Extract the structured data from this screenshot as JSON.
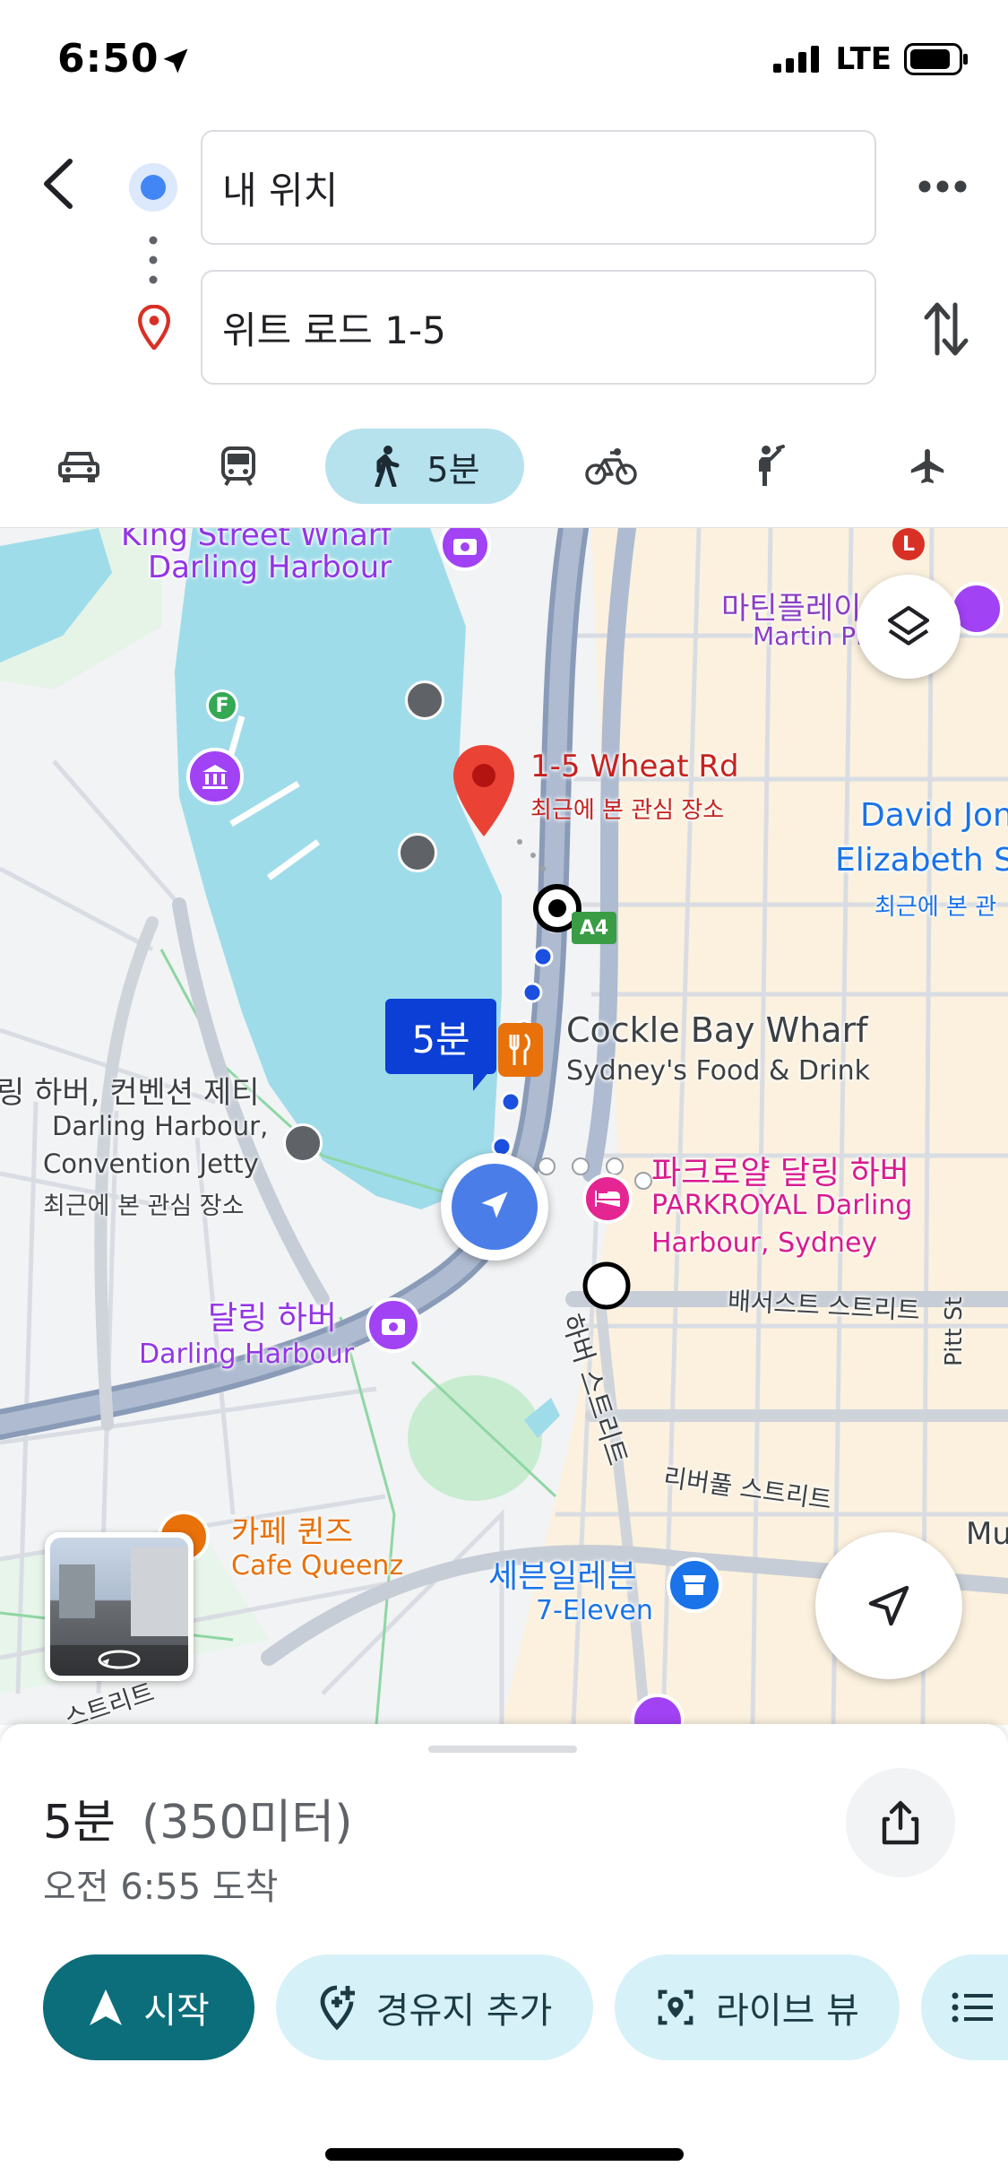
{
  "status": {
    "time": "6:50",
    "network": "LTE"
  },
  "search": {
    "origin": "내 위치",
    "destination": "위트 로드 1-5"
  },
  "modes": {
    "walk_time": "5분"
  },
  "map": {
    "labels": {
      "king_street": "King Street Wharf",
      "darling_top": "Darling Harbour",
      "martin_ko": "마틴플레이",
      "martin_en": "Martin Pl",
      "dest_title": "1-5 Wheat Rd",
      "dest_sub": "최근에 본 관심 장소",
      "david_jones_1": "David Jon",
      "david_jones_2": "Elizabeth S",
      "david_sub": "최근에 본 관",
      "road_badge": "A4",
      "route_time": "5분",
      "cockle_title": "Cockle Bay Wharf",
      "cockle_sub": "Sydney's Food & Drink",
      "jetty_ko": "링 하버, 컨벤션 제티",
      "jetty_en1": "Darling Harbour,",
      "jetty_en2": "Convention Jetty",
      "jetty_sub": "최근에 본 관심 장소",
      "parkroyal_ko": "파크로얄 달링 하버",
      "parkroyal_en1": "PARKROYAL Darling",
      "parkroyal_en2": "Harbour, Sydney",
      "bathurst": "배서스트 스트리트",
      "pitt": "Pitt St",
      "darling_ko": "달링 하버",
      "darling_en": "Darling Harbour",
      "harbour_st": "하버 스트리트",
      "liverpool": "리버풀 스트리트",
      "mu": "Mu",
      "cafe_ko": "카페 퀸즈",
      "cafe_en": "Cafe Queenz",
      "seven_ko": "세븐일레븐",
      "seven_en": "7-Eleven",
      "street_bottom": "스트리트",
      "transit_letter": "L",
      "ferry_letter": "F"
    }
  },
  "summary": {
    "duration": "5분",
    "distance": "(350미터)",
    "arrival": "오전 6:55 도착"
  },
  "actions": {
    "start": "시작",
    "add_stop": "경유지 추가",
    "live_view": "라이브 뷰"
  },
  "colors": {
    "accent": "#0b6e7a",
    "route": "#1a4fe0",
    "water": "#9fdcea",
    "chip": "#d6f1f8"
  }
}
